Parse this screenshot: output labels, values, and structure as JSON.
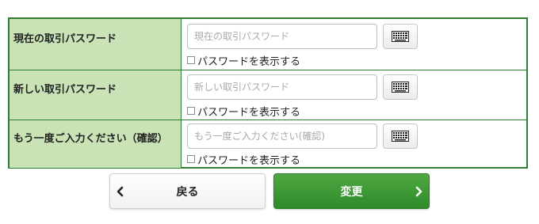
{
  "form": {
    "rows": [
      {
        "label": "現在の取引パスワード",
        "placeholder": "現在の取引パスワード",
        "show_label": "パスワードを表示する"
      },
      {
        "label": "新しい取引パスワード",
        "placeholder": "新しい取引パスワード",
        "show_label": "パスワードを表示する"
      },
      {
        "label": "もう一度ご入力ください（確認）",
        "placeholder": "もう一度ご入力ください(確認)",
        "show_label": "パスワードを表示する"
      }
    ],
    "keyboard_icon": "keyboard-icon"
  },
  "buttons": {
    "back_label": "戻る",
    "submit_label": "変更",
    "back_icon": "chevron-left-icon",
    "submit_icon": "chevron-right-icon"
  },
  "colors": {
    "label_bg": "#c9e3b6",
    "border": "#2e7d32",
    "submit_bg": "#3d9a35"
  }
}
